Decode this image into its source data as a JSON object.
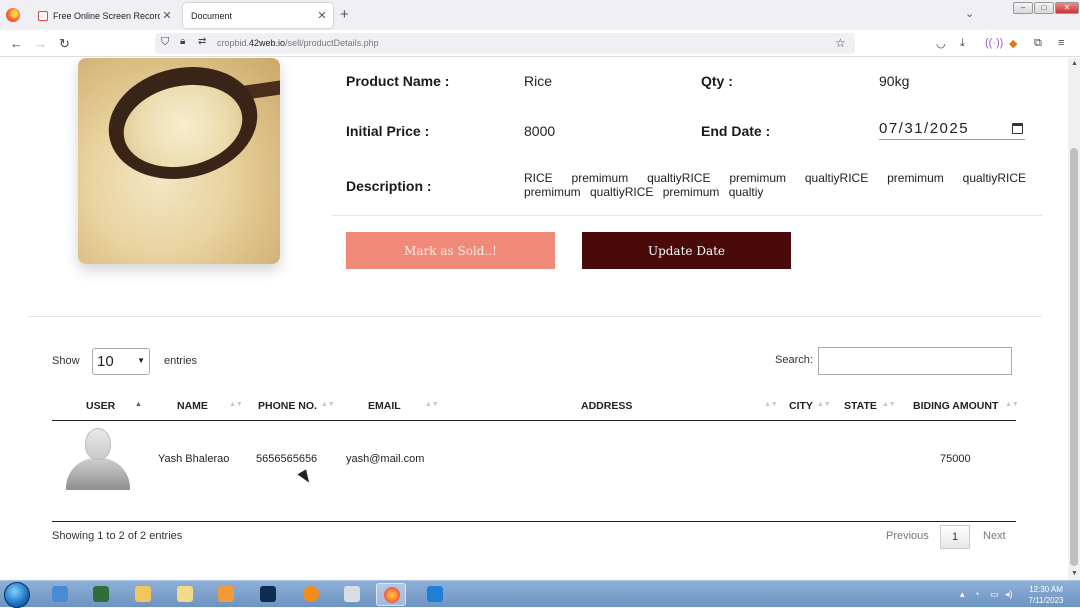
{
  "browser": {
    "tabs": [
      {
        "title": "Free Online Screen Recorder &",
        "active": false
      },
      {
        "title": "Document",
        "active": true
      }
    ],
    "url": {
      "prefix": "cropbid.",
      "host": "42web.io",
      "path": "/sell/productDetails.php"
    }
  },
  "product": {
    "name_label": "Product Name :",
    "name": "Rice",
    "qty_label": "Qty :",
    "qty": "90kg",
    "price_label": "Initial Price :",
    "price": "8000",
    "end_date_label": "End Date :",
    "end_date": "07/31/2025",
    "description_label": "Description :",
    "description": "RICE premimum qualtiyRICE premimum qualtiyRICE premimum qualtiyRICE premimum qualtiyRICE premimum qualtiy",
    "sold_button": "Mark as Sold..!",
    "update_button": "Update Date"
  },
  "table_controls": {
    "show_label": "Show",
    "page_length": "10",
    "entries_label": "entries",
    "search_label": "Search:",
    "search_value": ""
  },
  "table": {
    "headers": [
      "USER",
      "NAME",
      "PHONE NO.",
      "EMAIL",
      "ADDRESS",
      "CITY",
      "STATE",
      "BIDING AMOUNT"
    ],
    "rows": [
      {
        "name": "Yash Bhalerao",
        "phone": "5656565656",
        "email": "yash@mail.com",
        "address": "",
        "city": "",
        "state": "",
        "amount": "75000"
      }
    ],
    "info": "Showing 1 to 2 of 2 entries",
    "pagination": {
      "previous": "Previous",
      "current": "1",
      "next": "Next"
    }
  },
  "taskbar": {
    "time": "12:30 AM",
    "date": "7/11/2023"
  },
  "colors": {
    "sold_button": "#f08a78",
    "update_button": "#4a0a0a"
  }
}
